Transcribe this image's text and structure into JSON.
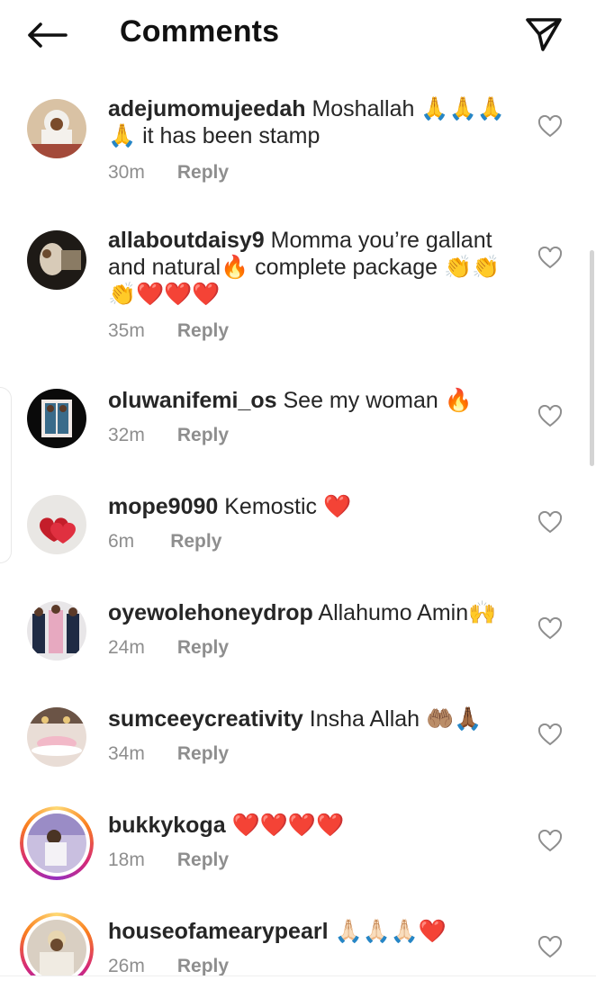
{
  "header": {
    "title": "Comments",
    "back_icon": "arrow-left-icon",
    "share_icon": "paper-plane-icon"
  },
  "colors": {
    "text": "#262626",
    "muted": "#8e8e8e",
    "heart_emoji": "#e0245e"
  },
  "comments": [
    {
      "username": "adejumomujeedah",
      "text": "Moshallah 🙏🙏🙏🙏 it has been stamp",
      "time": "30m",
      "reply": "Reply"
    },
    {
      "username": "allaboutdaisy9",
      "text": "Momma you’re gallant and natural🔥 complete package 👏👏👏❤️❤️❤️",
      "time": "35m",
      "reply": "Reply"
    },
    {
      "username": "oluwanifemi_os",
      "text": "See my woman 🔥",
      "time": "32m",
      "reply": "Reply"
    },
    {
      "username": "mope9090",
      "text": "Kemostic ❤️",
      "time": "6m",
      "reply": "Reply"
    },
    {
      "username": "oyewolehoneydrop",
      "text": "Allahumo Amin🙌",
      "time": "24m",
      "reply": "Reply"
    },
    {
      "username": "sumceeycreativity",
      "text": "Insha Allah 🤲🏽🙏🏾",
      "time": "34m",
      "reply": "Reply"
    },
    {
      "username": "bukkykoga",
      "text": "❤️❤️❤️❤️",
      "time": "18m",
      "reply": "Reply"
    },
    {
      "username": "houseofamearypearl",
      "text": "🙏🏻🙏🏻🙏🏻❤️",
      "time": "26m",
      "reply": "Reply"
    }
  ]
}
